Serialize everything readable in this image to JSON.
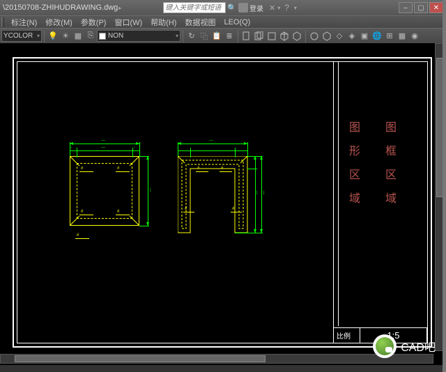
{
  "titlebar": {
    "filename": "\\20150708-ZHIHUDRAWING.dwg",
    "search_placeholder": "键入关键字或短语",
    "login": "登录"
  },
  "menu": {
    "items": [
      "标注(N)",
      "修改(M)",
      "参数(P)",
      "窗口(W)",
      "帮助(H)",
      "数据视图",
      "LEO(Q)"
    ]
  },
  "toolbar": {
    "color_sel": "YCOLOR",
    "non_label": "NON"
  },
  "drawing": {
    "title_block": {
      "left_col": [
        "图",
        "形",
        "区",
        "域"
      ],
      "right_col": [
        "图",
        "框",
        "区",
        "域"
      ],
      "footer_label": "比例",
      "footer_scale": "1:5"
    }
  },
  "watermark": {
    "text": "CAD吧"
  }
}
